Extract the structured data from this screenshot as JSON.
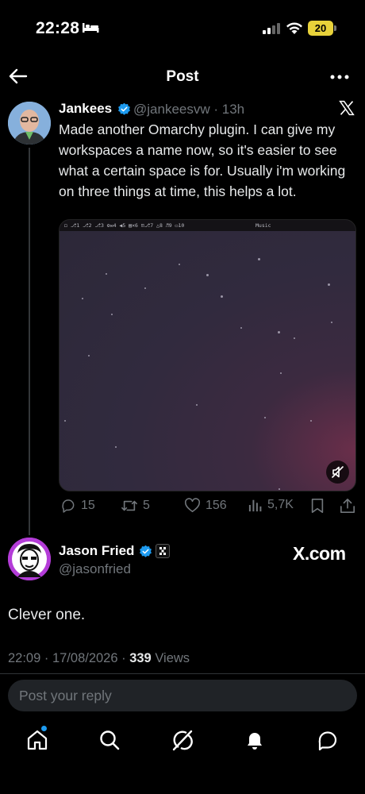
{
  "status_bar": {
    "time": "22:28",
    "battery": "20",
    "battery_color": "#e8d23a"
  },
  "header": {
    "title": "Post"
  },
  "tweet": {
    "author_name": "Jankees",
    "handle_time": "@jankeesvw · 13h",
    "text": "Made another Omarchy plugin. I can give my workspaces a name now, so it's easier to see what a certain space is for. Usually i'm working on three things at time, this helps a lot.",
    "media": {
      "bar_text": "◻ ⎇1 ⎇2 ⎇3 ⚙✉4 ◀5 ▤✕6 ⊡⎇7 △8 ♬9 ▭10",
      "bar_music": "Music"
    },
    "stats": {
      "replies": "15",
      "reposts": "5",
      "likes": "156",
      "views": "5,7K"
    }
  },
  "reply": {
    "author_name": "Jason Fried",
    "handle": "@jasonfried",
    "source": "X.com",
    "text": "Clever one.",
    "timestamp": "22:09 · 17/08/2026 · ",
    "views_count": "339",
    "views_label": " Views"
  },
  "compose": {
    "placeholder": "Post your reply"
  },
  "colors": {
    "accent": "#1d9bf0",
    "background": "#000000",
    "muted": "#71767b"
  },
  "nav": [
    "home-icon",
    "search-icon",
    "grok-icon",
    "notifications-icon",
    "messages-icon"
  ]
}
